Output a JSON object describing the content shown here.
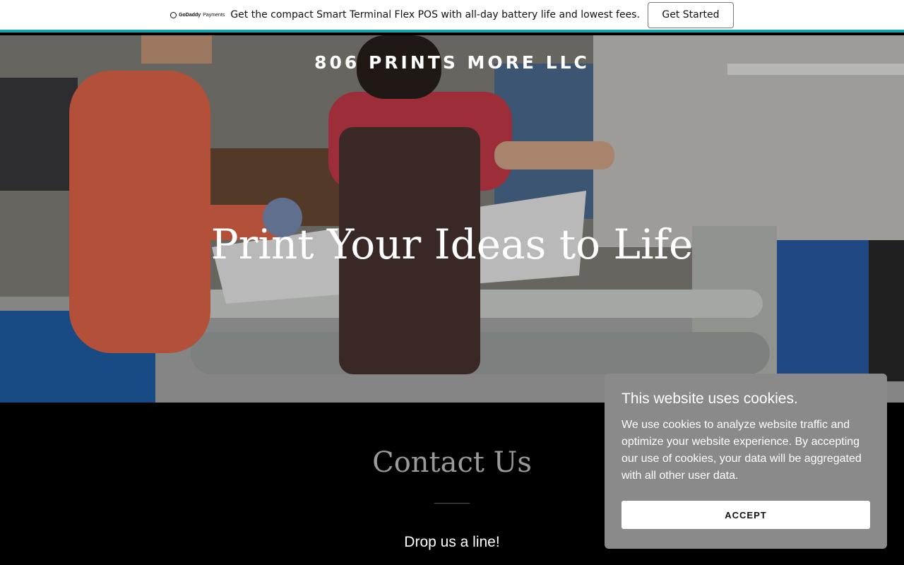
{
  "promo": {
    "logo_brand": "GoDaddy",
    "logo_sub": "Payments",
    "text": "Get the compact Smart Terminal Flex POS with all-day battery life and lowest fees.",
    "button_label": "Get Started"
  },
  "hero": {
    "site_title": "806 PRINTS MORE LLC",
    "tagline": "Print Your Ideas to Life"
  },
  "contact": {
    "title": "Contact Us",
    "subtitle": "Drop us a line!"
  },
  "cookie": {
    "title": "This website uses cookies.",
    "body": "We use cookies to analyze website traffic and optimize your website experience. By accepting our use of cookies, your data will be aggregated with all other user data.",
    "accept_label": "ACCEPT"
  },
  "colors": {
    "accent_bar": "#1aa3a8",
    "cookie_bg": "#8a8a8a"
  }
}
